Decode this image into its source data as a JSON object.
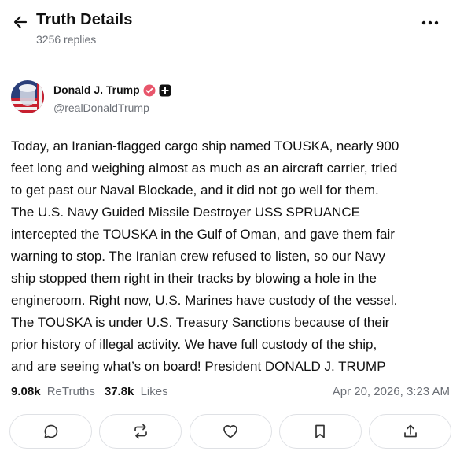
{
  "header": {
    "title": "Truth Details",
    "replies": "3256 replies"
  },
  "author": {
    "name": "Donald J. Trump",
    "handle": "@realDonaldTrump"
  },
  "post": {
    "text": "Today, an Iranian-flagged cargo ship named TOUSKA, nearly 900\nfeet long and weighing almost as much as an aircraft carrier, tried\nto get past our Naval Blockade, and it did not go well for them.\nThe U.S. Navy Guided Missile Destroyer USS SPRUANCE\nintercepted the TOUSKA in the Gulf of Oman, and gave them fair\nwarning to stop. The Iranian crew refused to listen, so our Navy\nship stopped them right in their tracks by blowing a hole in the\nengineroom. Right now, U.S. Marines have custody of the vessel.\nThe TOUSKA is under U.S. Treasury Sanctions because of their\nprior history of illegal activity. We have full custody of the ship,\nand are seeing what’s on board! President DONALD J. TRUMP"
  },
  "stats": {
    "retruths_count": "9.08k",
    "retruths_label": "ReTruths",
    "likes_count": "37.8k",
    "likes_label": "Likes",
    "timestamp": "Apr 20, 2026, 3:23 AM"
  },
  "actions": [
    "reply-icon",
    "retruth-icon",
    "like-icon",
    "bookmark-icon",
    "share-icon"
  ],
  "colors": {
    "verified_badge": "#e8566b",
    "text_primary": "#111111",
    "text_secondary": "#6b6f76",
    "border": "#dfe1e5"
  }
}
